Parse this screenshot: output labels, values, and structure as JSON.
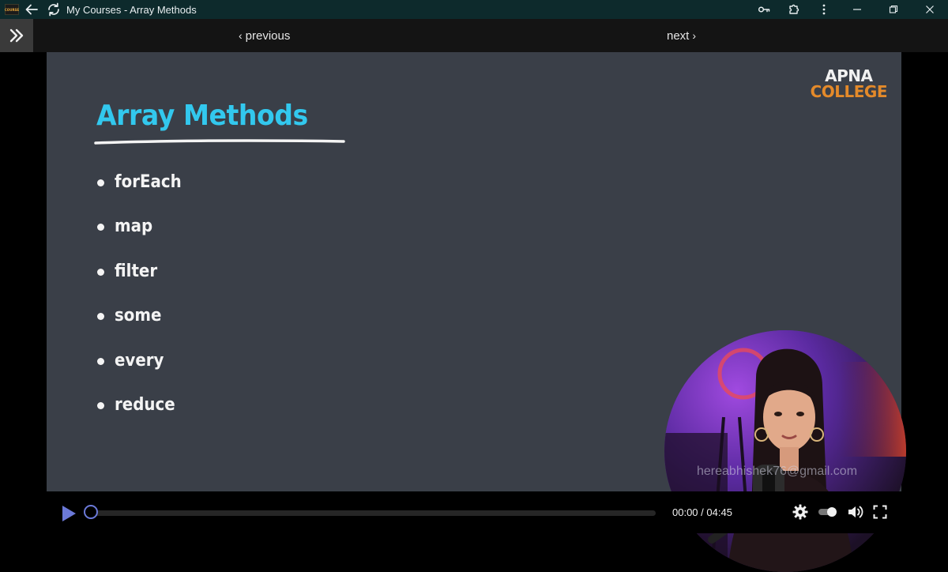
{
  "window": {
    "app_logo_text": "COURSE",
    "title": "My Courses - Array Methods"
  },
  "nav": {
    "previous_label": "previous",
    "next_label": "next"
  },
  "slide": {
    "brand_top": "APNA",
    "brand_bottom": "COLLEGE",
    "title": "Array Methods",
    "methods": [
      "forEach",
      "map",
      "filter",
      "some",
      "every",
      "reduce"
    ],
    "title_color": "#32c8ee",
    "background_color": "#3a3f48"
  },
  "webcam": {
    "watermark": "hereabhishek76@gmail.com"
  },
  "player": {
    "current_time": "00:00",
    "duration": "04:45",
    "time_separator": " / ",
    "progress_fraction": 0.0,
    "accent_color": "#6b79d8"
  },
  "icons": {
    "back": "arrow-left-icon",
    "reload": "reload-icon",
    "key": "key-icon",
    "extensions": "puzzle-icon",
    "menu": "kebab-menu-icon",
    "minimize": "minimize-icon",
    "restore": "restore-icon",
    "close": "close-icon",
    "sidebar": "double-chevron-right-icon",
    "play": "play-icon",
    "settings": "gear-icon",
    "autoplay": "toggle-icon",
    "volume": "volume-icon",
    "fullscreen": "fullscreen-icon"
  }
}
